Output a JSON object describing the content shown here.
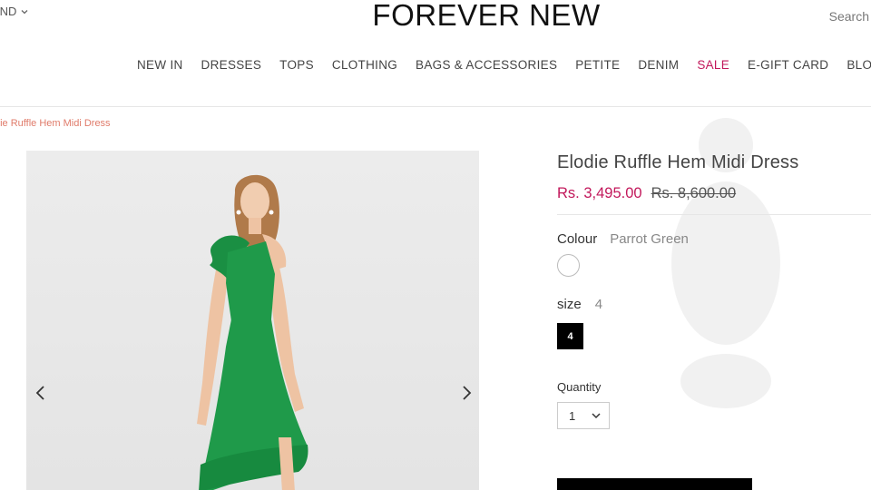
{
  "header": {
    "region_label": "IND",
    "logo_text": "FOREVER NEW",
    "search_label": "Search"
  },
  "nav": {
    "items": [
      "NEW IN",
      "DRESSES",
      "TOPS",
      "CLOTHING",
      "BAGS & ACCESSORIES",
      "PETITE",
      "DENIM",
      "SALE",
      "E-GIFT CARD",
      "BLOG"
    ]
  },
  "breadcrumb": "die Ruffle Hem Midi Dress",
  "product": {
    "title": "Elodie Ruffle Hem Midi Dress",
    "price_now": "Rs. 3,495.00",
    "price_was": "Rs. 8,600.00",
    "colour_label": "Colour",
    "colour_value": "Parrot Green",
    "size_label": "size",
    "size_value": "4",
    "size_options": [
      "4"
    ],
    "quantity_label": "Quantity",
    "quantity_value": "1"
  },
  "icons": {
    "region": "chevron-down-icon",
    "prev": "chevron-left-icon",
    "next": "chevron-right-icon",
    "qty": "chevron-down-icon"
  },
  "colors": {
    "accent": "#c2185b",
    "breadcrumb": "#e07b6a",
    "dress_green": "#1f9a4a"
  }
}
